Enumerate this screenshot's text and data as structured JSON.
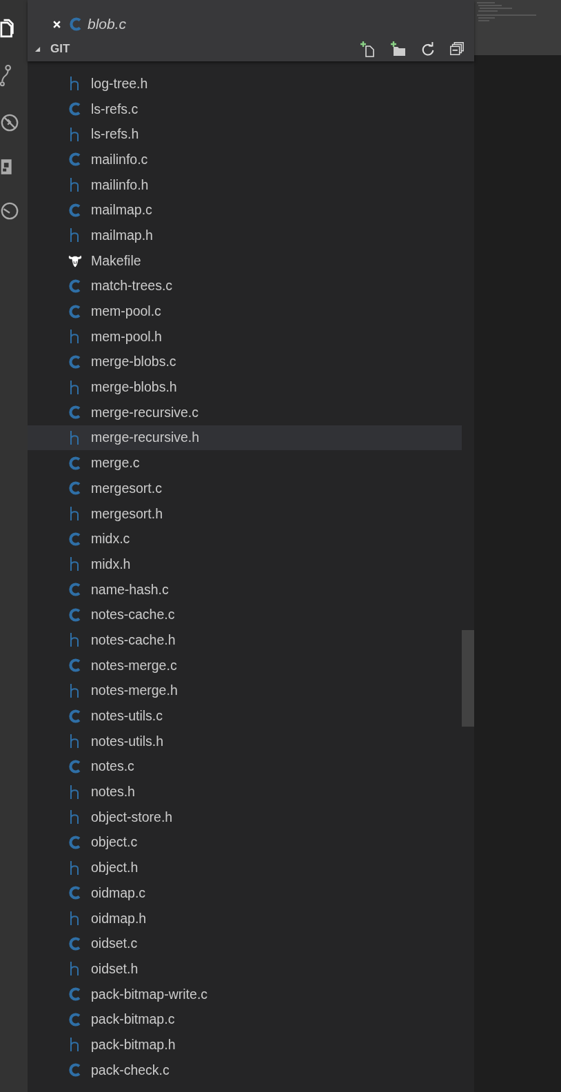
{
  "open_editors": [
    {
      "name": "blob.c",
      "kind": "c"
    }
  ],
  "section": {
    "title": "GIT",
    "expanded": true
  },
  "files": [
    {
      "name": "log-tree.h",
      "kind": "h",
      "selected": false
    },
    {
      "name": "ls-refs.c",
      "kind": "c",
      "selected": false
    },
    {
      "name": "ls-refs.h",
      "kind": "h",
      "selected": false
    },
    {
      "name": "mailinfo.c",
      "kind": "c",
      "selected": false
    },
    {
      "name": "mailinfo.h",
      "kind": "h",
      "selected": false
    },
    {
      "name": "mailmap.c",
      "kind": "c",
      "selected": false
    },
    {
      "name": "mailmap.h",
      "kind": "h",
      "selected": false
    },
    {
      "name": "Makefile",
      "kind": "makefile",
      "selected": false
    },
    {
      "name": "match-trees.c",
      "kind": "c",
      "selected": false
    },
    {
      "name": "mem-pool.c",
      "kind": "c",
      "selected": false
    },
    {
      "name": "mem-pool.h",
      "kind": "h",
      "selected": false
    },
    {
      "name": "merge-blobs.c",
      "kind": "c",
      "selected": false
    },
    {
      "name": "merge-blobs.h",
      "kind": "h",
      "selected": false
    },
    {
      "name": "merge-recursive.c",
      "kind": "c",
      "selected": false
    },
    {
      "name": "merge-recursive.h",
      "kind": "h",
      "selected": true
    },
    {
      "name": "merge.c",
      "kind": "c",
      "selected": false
    },
    {
      "name": "mergesort.c",
      "kind": "c",
      "selected": false
    },
    {
      "name": "mergesort.h",
      "kind": "h",
      "selected": false
    },
    {
      "name": "midx.c",
      "kind": "c",
      "selected": false
    },
    {
      "name": "midx.h",
      "kind": "h",
      "selected": false
    },
    {
      "name": "name-hash.c",
      "kind": "c",
      "selected": false
    },
    {
      "name": "notes-cache.c",
      "kind": "c",
      "selected": false
    },
    {
      "name": "notes-cache.h",
      "kind": "h",
      "selected": false
    },
    {
      "name": "notes-merge.c",
      "kind": "c",
      "selected": false
    },
    {
      "name": "notes-merge.h",
      "kind": "h",
      "selected": false
    },
    {
      "name": "notes-utils.c",
      "kind": "c",
      "selected": false
    },
    {
      "name": "notes-utils.h",
      "kind": "h",
      "selected": false
    },
    {
      "name": "notes.c",
      "kind": "c",
      "selected": false
    },
    {
      "name": "notes.h",
      "kind": "h",
      "selected": false
    },
    {
      "name": "object-store.h",
      "kind": "h",
      "selected": false
    },
    {
      "name": "object.c",
      "kind": "c",
      "selected": false
    },
    {
      "name": "object.h",
      "kind": "h",
      "selected": false
    },
    {
      "name": "oidmap.c",
      "kind": "c",
      "selected": false
    },
    {
      "name": "oidmap.h",
      "kind": "h",
      "selected": false
    },
    {
      "name": "oidset.c",
      "kind": "c",
      "selected": false
    },
    {
      "name": "oidset.h",
      "kind": "h",
      "selected": false
    },
    {
      "name": "pack-bitmap-write.c",
      "kind": "c",
      "selected": false
    },
    {
      "name": "pack-bitmap.c",
      "kind": "c",
      "selected": false
    },
    {
      "name": "pack-bitmap.h",
      "kind": "h",
      "selected": false
    },
    {
      "name": "pack-check.c",
      "kind": "c",
      "selected": false
    }
  ]
}
